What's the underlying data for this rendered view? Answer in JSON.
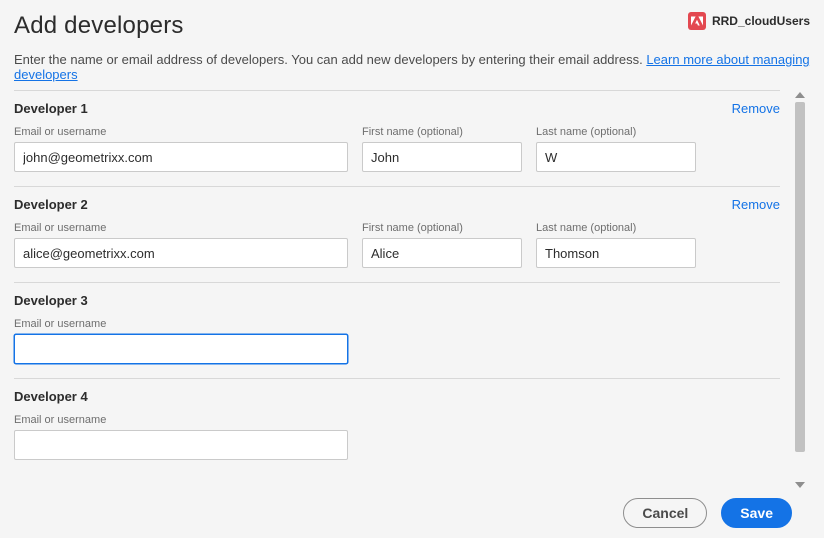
{
  "header": {
    "title": "Add developers",
    "org_name": "RRD_cloudUsers"
  },
  "subtitle": {
    "text": "Enter the name or email address of developers. You can add new developers by entering their email address. ",
    "link_text": "Learn more about managing developers"
  },
  "labels": {
    "email": "Email or username",
    "first_name": "First name (optional)",
    "last_name": "Last name (optional)",
    "remove": "Remove"
  },
  "developers": [
    {
      "heading": "Developer 1",
      "email": "john@geometrixx.com",
      "first_name": "John",
      "last_name": "W",
      "show_names": true,
      "show_remove": true,
      "email_focused": false
    },
    {
      "heading": "Developer 2",
      "email": "alice@geometrixx.com",
      "first_name": "Alice",
      "last_name": "Thomson",
      "show_names": true,
      "show_remove": true,
      "email_focused": false
    },
    {
      "heading": "Developer 3",
      "email": "",
      "first_name": "",
      "last_name": "",
      "show_names": false,
      "show_remove": false,
      "email_focused": true
    },
    {
      "heading": "Developer 4",
      "email": "",
      "first_name": "",
      "last_name": "",
      "show_names": false,
      "show_remove": false,
      "email_focused": false
    }
  ],
  "footer": {
    "cancel": "Cancel",
    "save": "Save"
  }
}
